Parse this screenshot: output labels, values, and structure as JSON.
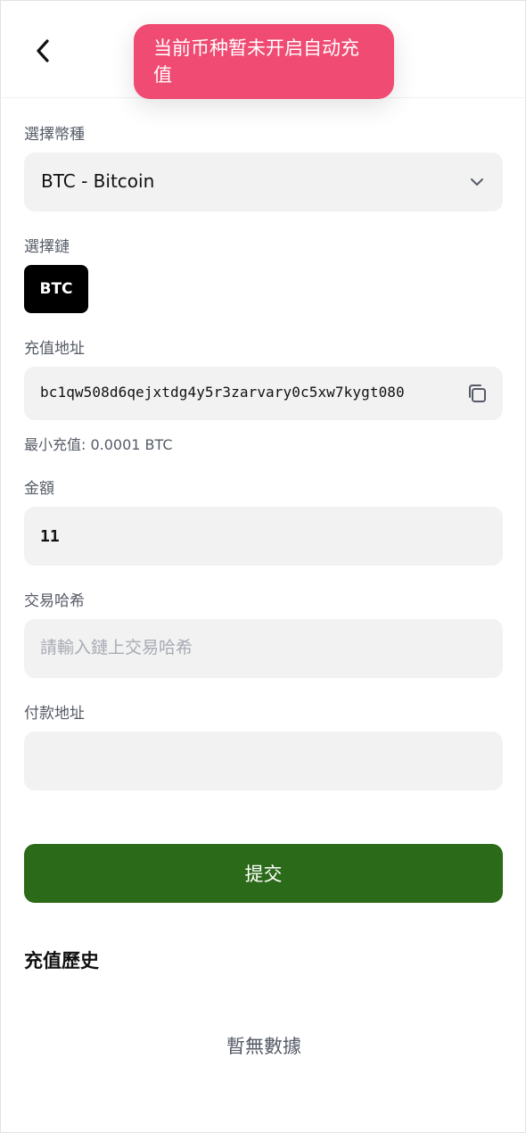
{
  "toast": {
    "message": "当前币种暂未开启自动充值"
  },
  "header": {
    "back_icon": "chevron-left-icon"
  },
  "currency": {
    "label": "選擇幣種",
    "selected": "BTC - Bitcoin",
    "icon": "chevron-down-icon"
  },
  "chain": {
    "label": "選擇鏈",
    "selected": "BTC"
  },
  "address": {
    "label": "充值地址",
    "value": "bc1qw508d6qejxtdg4y5r3zarvary0c5xw7kygt080",
    "copy_icon": "copy-icon"
  },
  "min_note": "最小充值: 0.0001 BTC",
  "amount": {
    "label": "金額",
    "value": "11"
  },
  "tx_hash": {
    "label": "交易哈希",
    "placeholder": "請輸入鏈上交易哈希",
    "value": ""
  },
  "pay_address": {
    "label": "付款地址",
    "value": ""
  },
  "submit_label": "提交",
  "history": {
    "title": "充值歷史",
    "empty_text": "暫無數據"
  },
  "colors": {
    "toast_bg": "#ef4b73",
    "submit_bg": "#2b6a18",
    "chain_selected_bg": "#000000",
    "field_bg": "#f2f2f2"
  }
}
